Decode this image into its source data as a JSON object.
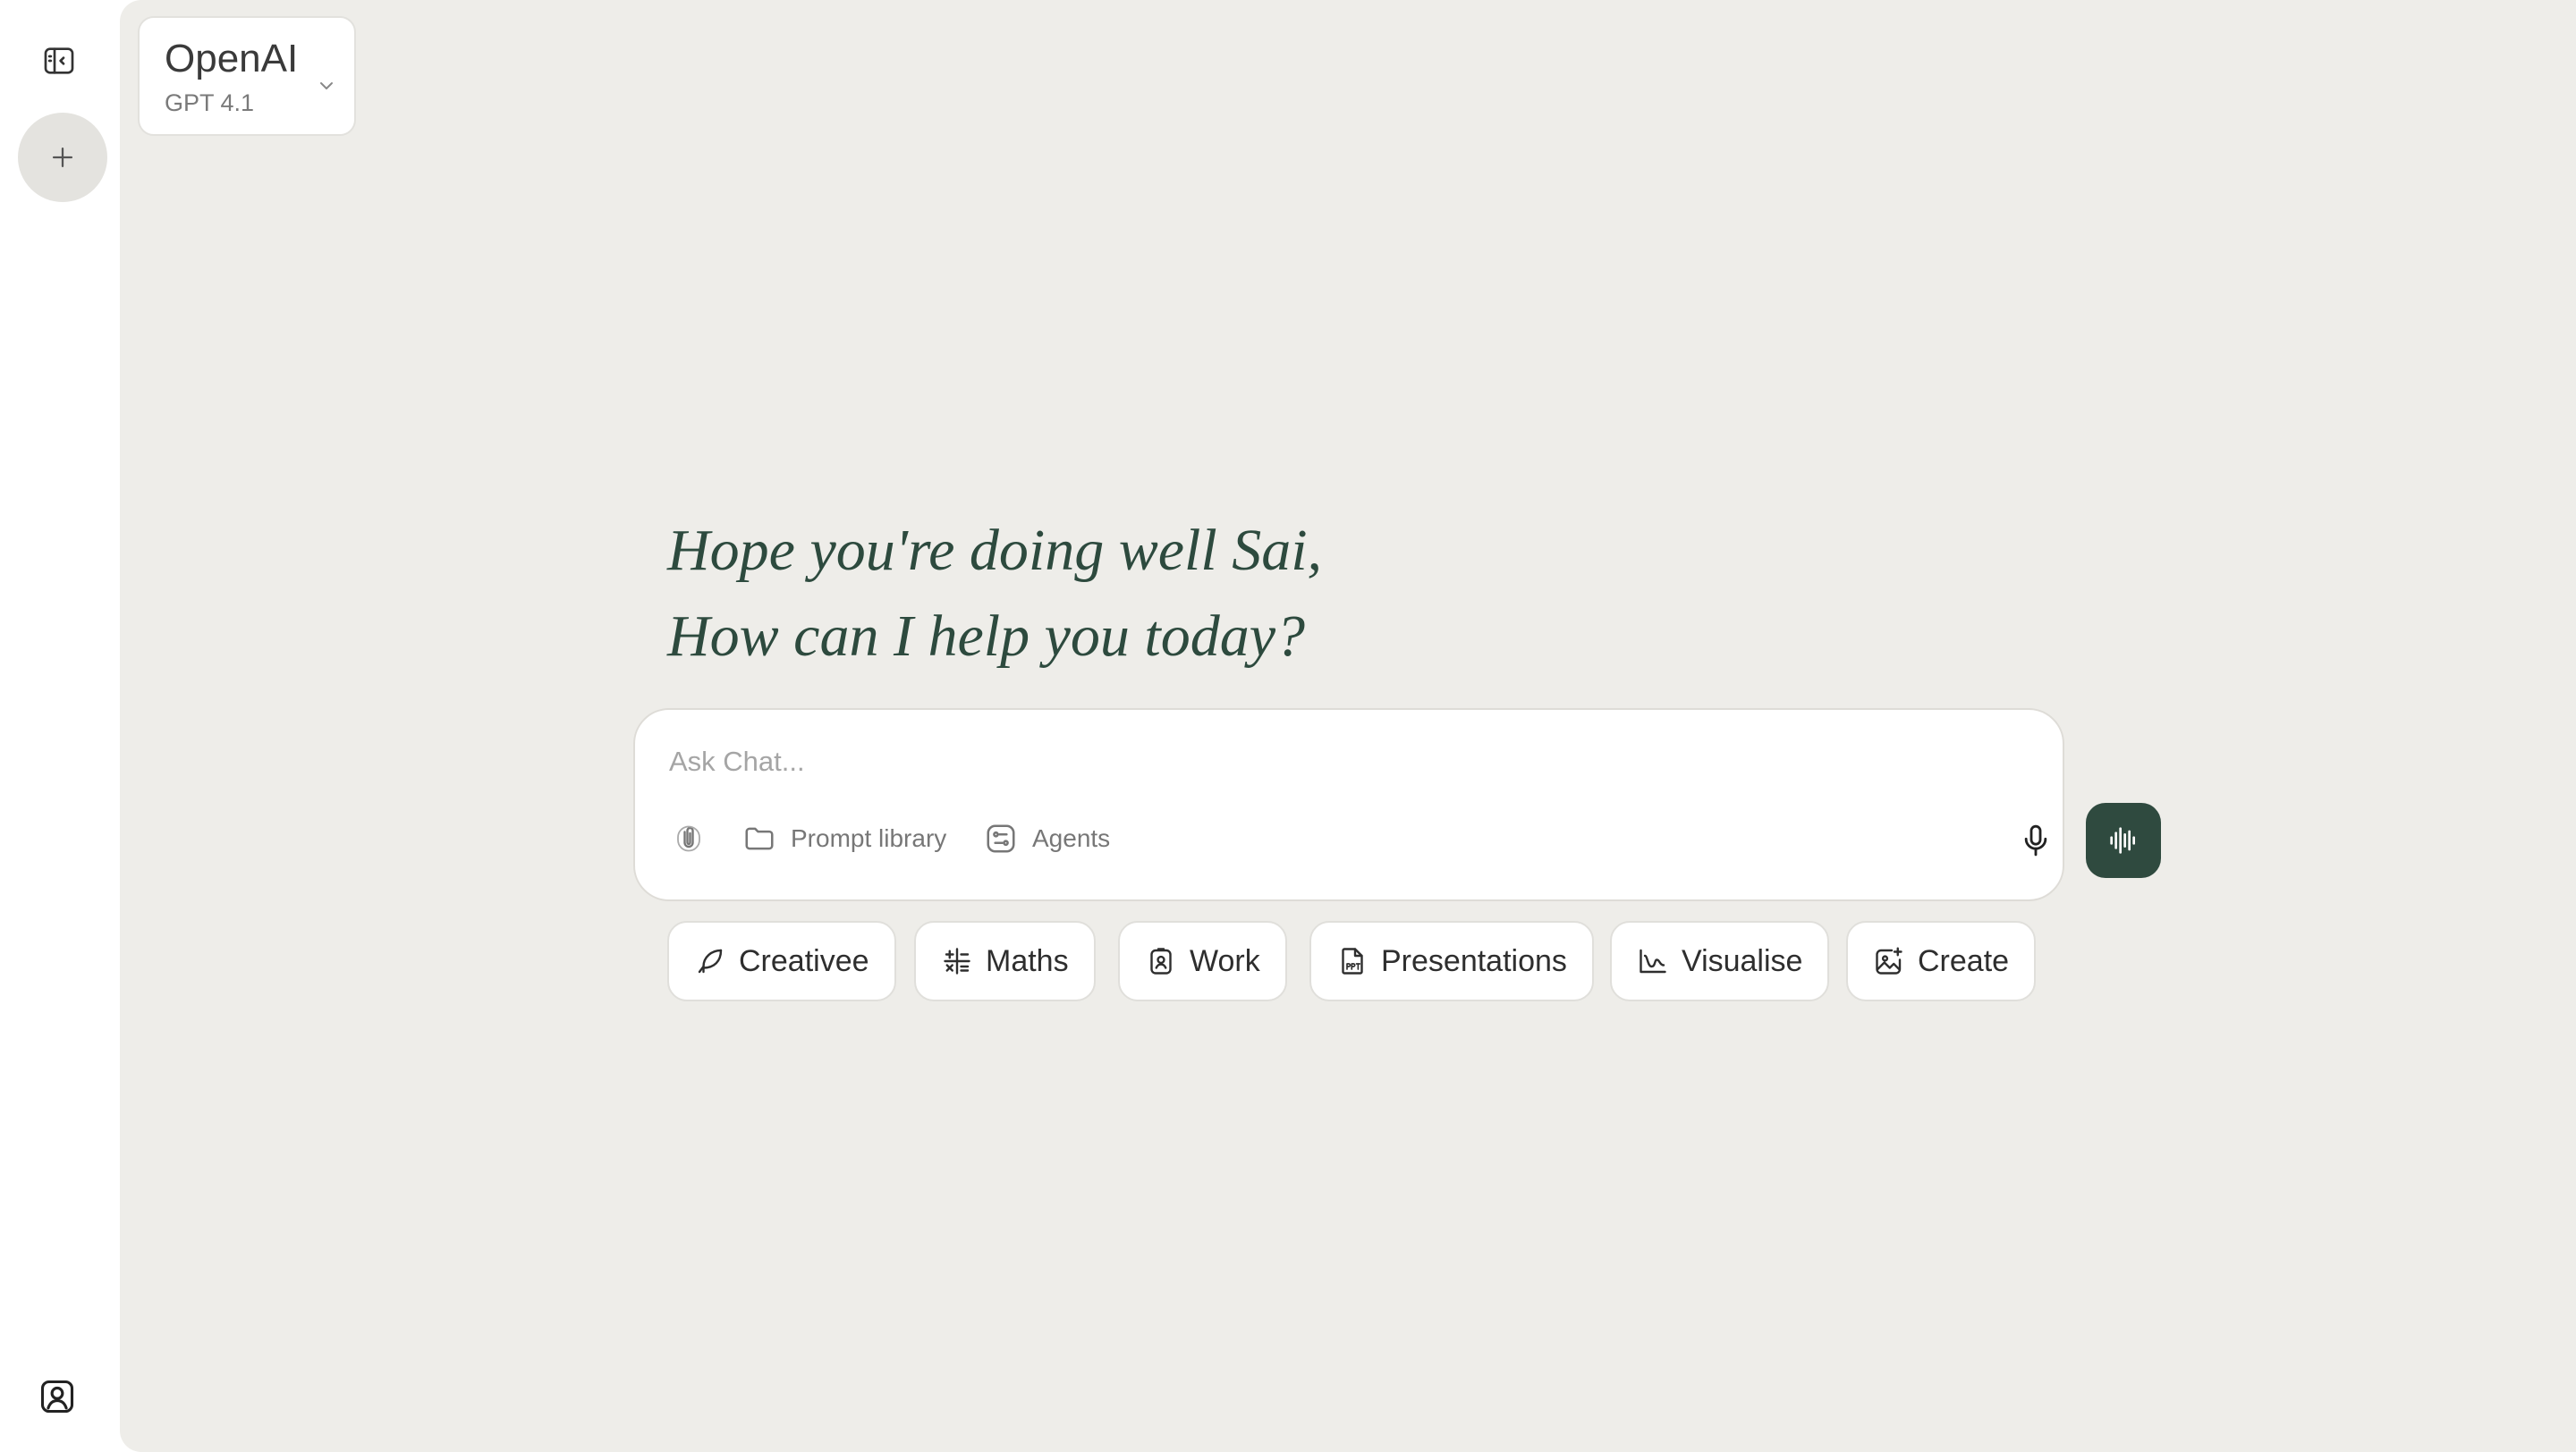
{
  "rail": {
    "toggle_icon": "sidebar-toggle-icon",
    "new_chat_icon": "plus-icon",
    "profile_icon": "user-profile-icon"
  },
  "model": {
    "provider": "OpenAI",
    "version": "GPT 4.1"
  },
  "greeting": {
    "line1": "Hope you're doing well Sai,",
    "line2": "How can I help you today?"
  },
  "composer": {
    "placeholder": "Ask Chat...",
    "value": "",
    "prompt_library_label": "Prompt library",
    "agents_label": "Agents"
  },
  "chips": [
    {
      "label": "Creativee",
      "icon": "feather-icon"
    },
    {
      "label": "Maths",
      "icon": "math-operators-icon"
    },
    {
      "label": "Work",
      "icon": "id-badge-icon"
    },
    {
      "label": "Presentations",
      "icon": "ppt-file-icon"
    },
    {
      "label": "Visualise",
      "icon": "chart-curve-icon"
    },
    {
      "label": "Create",
      "icon": "image-sparkle-icon"
    }
  ],
  "colors": {
    "accent": "#2f4a3f",
    "greeting": "#2d4a3e",
    "main_background": "#eeede9"
  }
}
